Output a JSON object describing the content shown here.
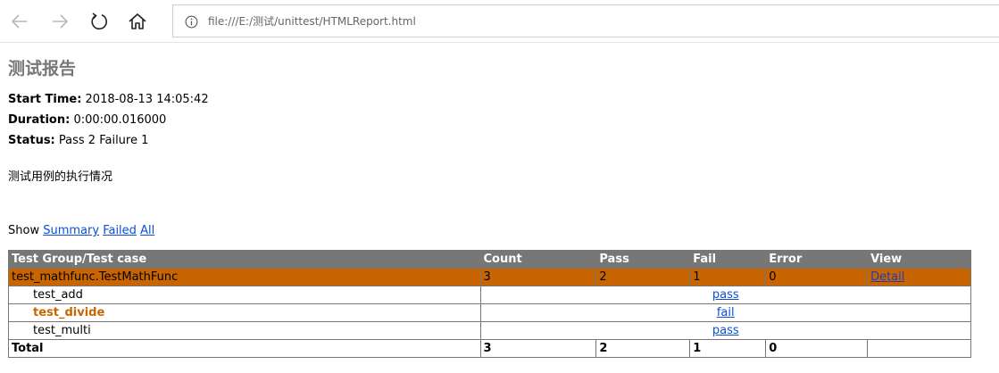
{
  "browser": {
    "url": "file:///E:/测试/unittest/HTMLReport.html"
  },
  "report": {
    "title": "测试报告",
    "start_time_label": "Start Time:",
    "start_time": "2018-08-13 14:05:42",
    "duration_label": "Duration:",
    "duration": "0:00:00.016000",
    "status_label": "Status:",
    "status": "Pass 2 Failure 1",
    "description": "测试用例的执行情况"
  },
  "filter": {
    "show_label": "Show",
    "summary": "Summary",
    "failed": "Failed",
    "all": "All"
  },
  "table": {
    "headers": [
      "Test Group/Test case",
      "Count",
      "Pass",
      "Fail",
      "Error",
      "View"
    ],
    "group": {
      "name": "test_mathfunc.TestMathFunc",
      "count": "3",
      "pass": "2",
      "fail": "1",
      "error": "0",
      "view": "Detail"
    },
    "cases": [
      {
        "name": "test_add",
        "result": "pass"
      },
      {
        "name": "test_divide",
        "result": "fail"
      },
      {
        "name": "test_multi",
        "result": "pass"
      }
    ],
    "total": {
      "label": "Total",
      "count": "3",
      "pass": "2",
      "fail": "1",
      "error": "0"
    }
  }
}
